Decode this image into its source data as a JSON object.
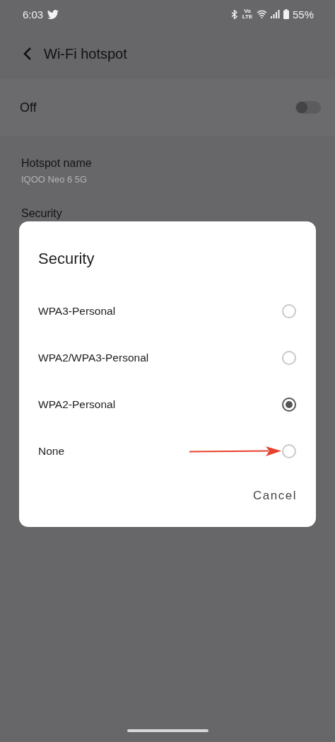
{
  "status_bar": {
    "time": "6:03",
    "volte": "Vo LTE",
    "battery": "55%"
  },
  "header": {
    "title": "Wi-Fi hotspot"
  },
  "hotspot_switch": {
    "label": "Off",
    "on": false
  },
  "hotspot_name": {
    "label": "Hotspot name",
    "value": "IQOO Neo 6 5G"
  },
  "security": {
    "label": "Security"
  },
  "dialog": {
    "title": "Security",
    "options": [
      {
        "label": "WPA3-Personal",
        "selected": false
      },
      {
        "label": "WPA2/WPA3-Personal",
        "selected": false
      },
      {
        "label": "WPA2-Personal",
        "selected": true
      },
      {
        "label": "None",
        "selected": false
      }
    ],
    "buttons": [
      "Cancel"
    ]
  }
}
